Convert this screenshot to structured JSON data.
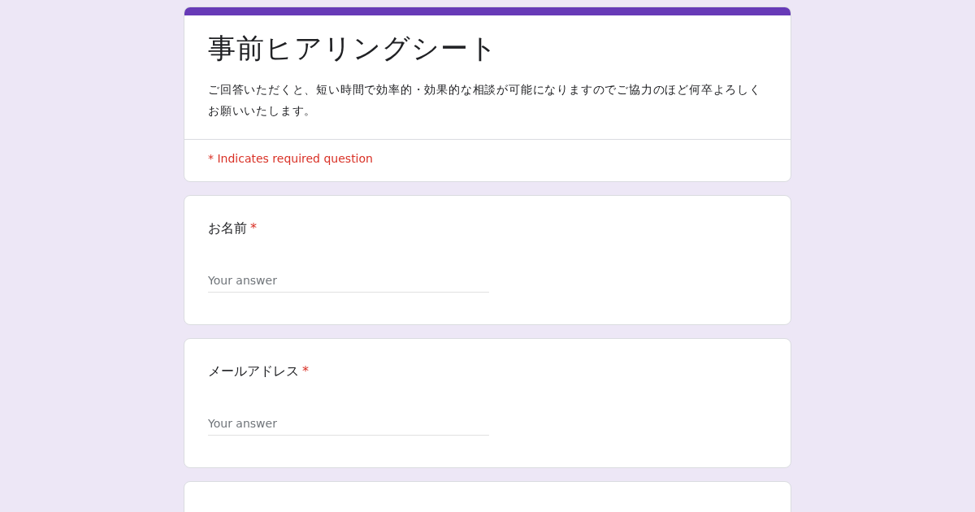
{
  "form": {
    "title": "事前ヒアリングシート",
    "description": "ご回答いただくと、短い時間で効率的・効果的な相談が可能になりますのでご協力のほど何卒よろしくお願いいたします。",
    "required_note": "* Indicates required question"
  },
  "required_mark": "*",
  "questions": [
    {
      "label": "お名前",
      "required": true,
      "placeholder": "Your answer"
    },
    {
      "label": "メールアドレス",
      "required": true,
      "placeholder": "Your answer"
    }
  ]
}
